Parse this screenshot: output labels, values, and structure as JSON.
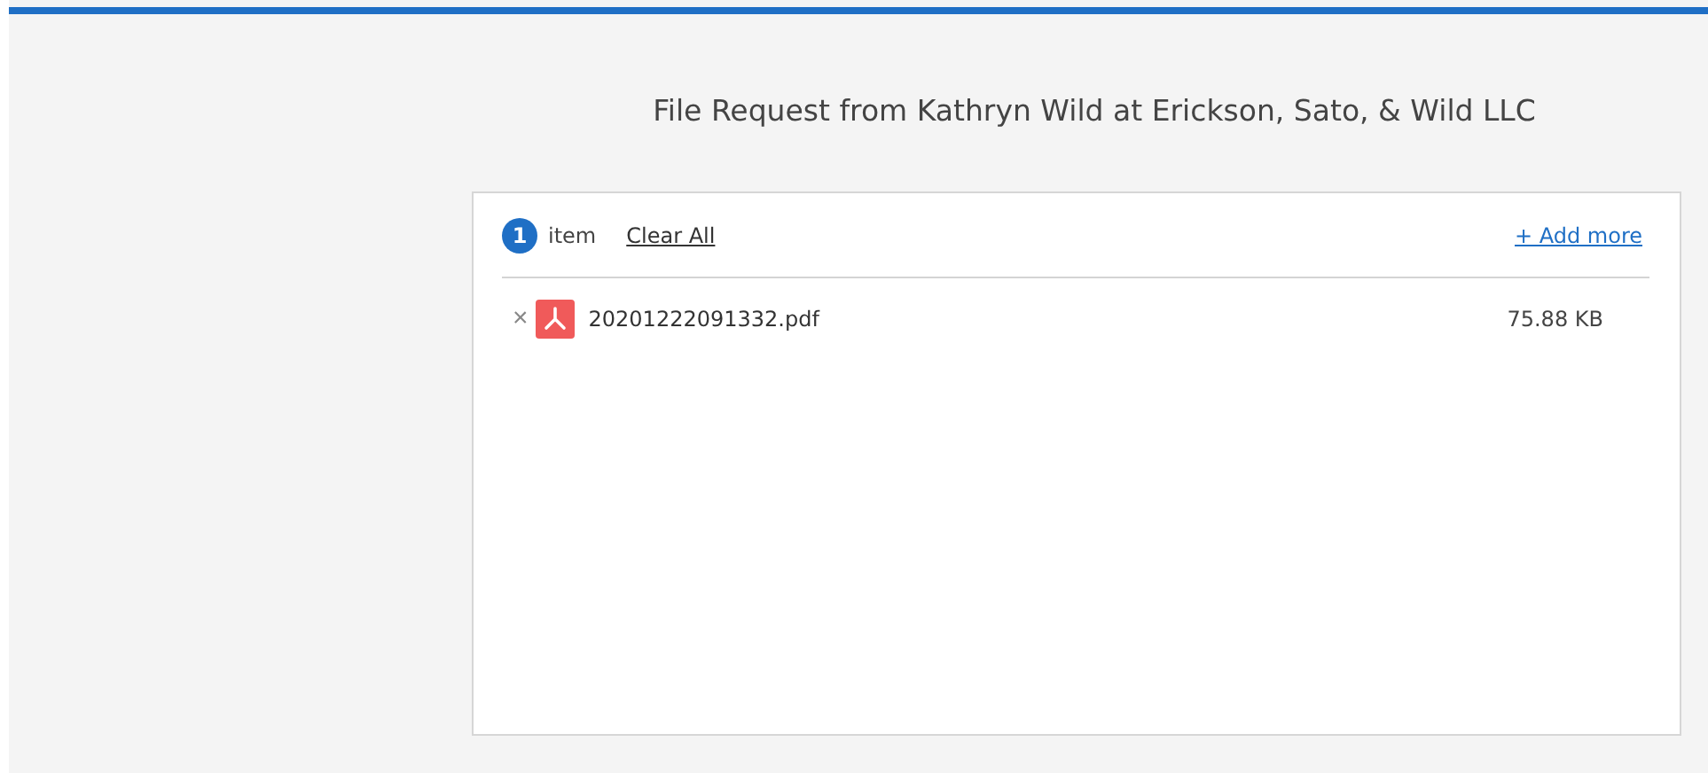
{
  "title": "File Request from Kathryn Wild at Erickson, Sato, & Wild LLC",
  "upload": {
    "count": "1",
    "count_label": "item",
    "clear_all": "Clear All",
    "add_more": "+ Add more",
    "files": [
      {
        "remove": "×",
        "name": "20201222091332.pdf",
        "size": "75.88 KB",
        "kind": "pdf"
      }
    ]
  }
}
